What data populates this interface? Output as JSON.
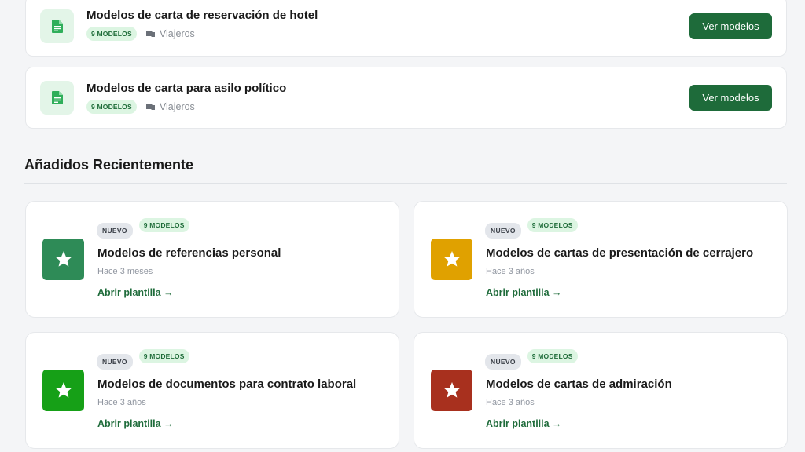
{
  "templates": [
    {
      "title": "Modelos de carta de reservación de hotel",
      "count_badge": "9 MODELOS",
      "category": "Viajeros",
      "button": "Ver modelos",
      "icon": "document-icon"
    },
    {
      "title": "Modelos de carta para asilo político",
      "count_badge": "9 MODELOS",
      "category": "Viajeros",
      "button": "Ver modelos",
      "icon": "document-icon"
    }
  ],
  "recent": {
    "heading": "Añadidos Recientemente",
    "items": [
      {
        "new_badge": "NUEVO",
        "count_badge": "9 MODELOS",
        "title": "Modelos de referencias personal",
        "time": "Hace 3 meses",
        "link": "Abrir plantilla →",
        "color": "#2e8b57",
        "icon": "star-icon"
      },
      {
        "new_badge": "NUEVO",
        "count_badge": "9 MODELOS",
        "title": "Modelos de cartas de presentación de cerrajero",
        "time": "Hace 3 años",
        "link": "Abrir plantilla →",
        "color": "#e0a100",
        "icon": "star-icon"
      },
      {
        "new_badge": "NUEVO",
        "count_badge": "9 MODELOS",
        "title": "Modelos de documentos para contrato laboral",
        "time": "Hace 3 años",
        "link": "Abrir plantilla →",
        "color": "#16a017",
        "icon": "star-icon"
      },
      {
        "new_badge": "NUEVO",
        "count_badge": "9 MODELOS",
        "title": "Modelos de cartas de admiración",
        "time": "Hace 3 años",
        "link": "Abrir plantilla →",
        "color": "#a8301e",
        "icon": "star-icon"
      }
    ]
  },
  "colors": {
    "primary_button": "#1e6b3a",
    "badge_green_bg": "#dcf5e2",
    "badge_grey_bg": "#e3e6eb",
    "doc_tile_bg": "#e3f5e8"
  }
}
